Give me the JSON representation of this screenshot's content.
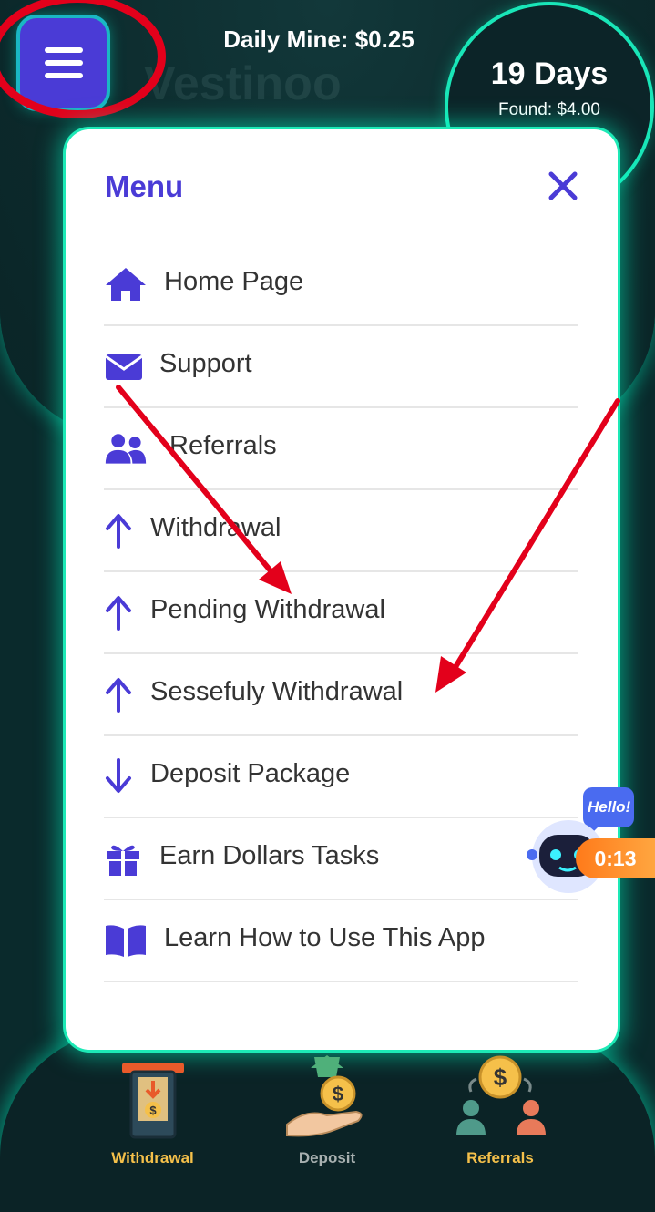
{
  "header": {
    "daily_mine": "Daily Mine: $0.25",
    "days": "19 Days",
    "found": "Found: $4.00",
    "watermark": "Vestinoo"
  },
  "menu": {
    "title": "Menu",
    "items": [
      {
        "label": "Home Page",
        "icon": "home-icon"
      },
      {
        "label": "Support",
        "icon": "envelope-icon"
      },
      {
        "label": "Referrals",
        "icon": "users-icon"
      },
      {
        "label": "Withdrawal",
        "icon": "arrow-up-icon"
      },
      {
        "label": "Pending Withdrawal",
        "icon": "arrow-up-icon"
      },
      {
        "label": "Sessefuly Withdrawal",
        "icon": "arrow-up-icon"
      },
      {
        "label": "Deposit Package",
        "icon": "arrow-down-icon"
      },
      {
        "label": "Earn Dollars Tasks",
        "icon": "gift-icon"
      },
      {
        "label": "Learn How to Use This App",
        "icon": "book-icon"
      }
    ]
  },
  "chat_widget": {
    "bubble": "Hello!",
    "timer": "0:13"
  },
  "bottom_nav": {
    "withdrawal": "Withdrawal",
    "deposit": "Deposit",
    "referrals": "Referrals"
  },
  "colors": {
    "accent": "#4a3bd6",
    "glow": "#1de9b6",
    "annotation_red": "#e3001b",
    "nav_gold": "#f5c04a",
    "nav_gray": "#a8b0b0"
  }
}
